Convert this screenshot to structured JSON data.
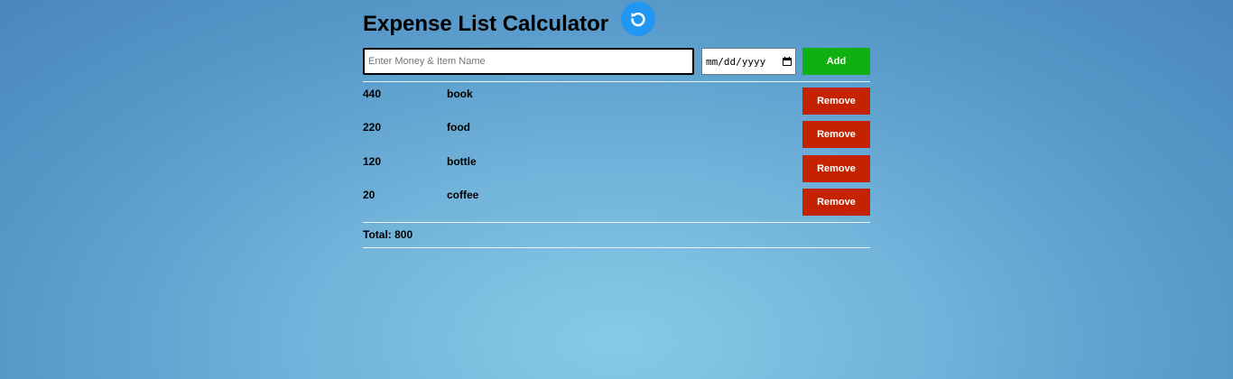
{
  "header": {
    "title": "Expense List Calculator",
    "reset_icon": "refresh-icon"
  },
  "form": {
    "money_placeholder": "Enter Money & Item Name",
    "money_value": "",
    "date_placeholder": "mm/dd/yyyy",
    "add_label": "Add"
  },
  "expenses": [
    {
      "amount": "440",
      "name": "book",
      "remove_label": "Remove"
    },
    {
      "amount": "220",
      "name": "food",
      "remove_label": "Remove"
    },
    {
      "amount": "120",
      "name": "bottle",
      "remove_label": "Remove"
    },
    {
      "amount": "20",
      "name": "coffee",
      "remove_label": "Remove"
    }
  ],
  "total": {
    "text": "Total: 800"
  },
  "colors": {
    "add_button": "#10b010",
    "remove_button": "#c42200",
    "reset_button": "#2196f3"
  }
}
